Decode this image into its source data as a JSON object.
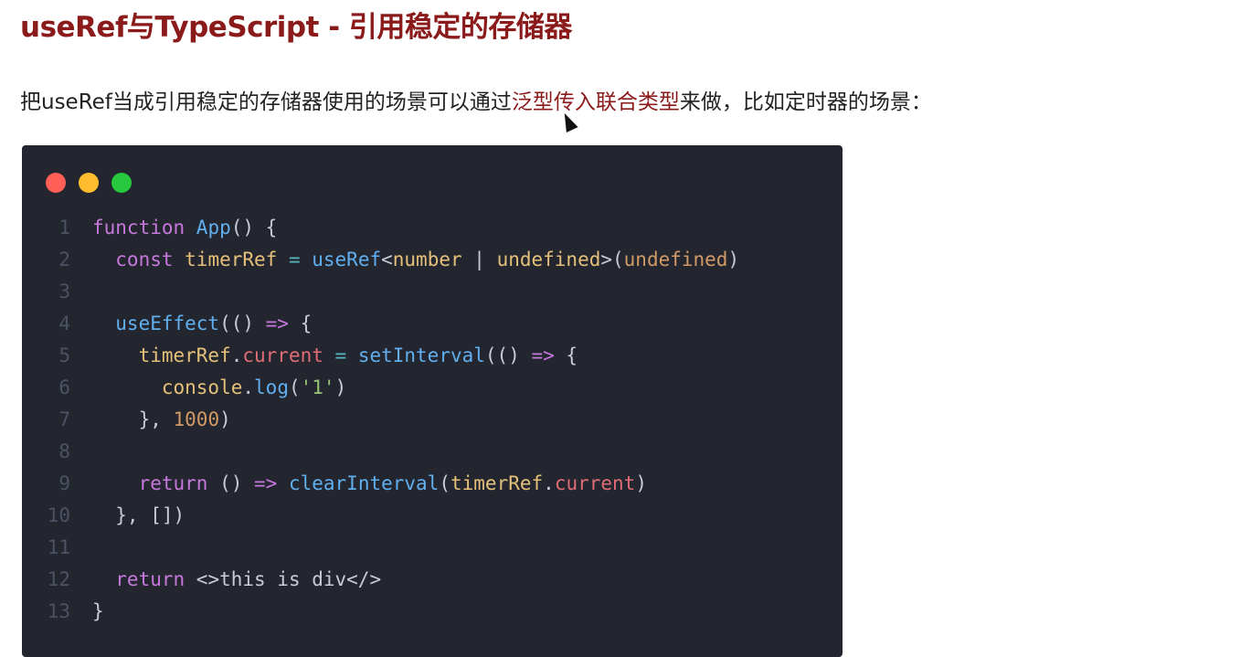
{
  "title": "useRef与TypeScript - 引用稳定的存储器",
  "paragraph": {
    "before": "把useRef当成引用稳定的存储器使用的场景可以通过",
    "highlight": "泛型传入联合类型",
    "after": "来做，比如定时器的场景："
  },
  "window_dots": [
    "#ff5f56",
    "#ffbd2e",
    "#27c93f"
  ],
  "code_lines": [
    {
      "num": "1",
      "tokens": [
        [
          "function ",
          "k"
        ],
        [
          "App",
          "f"
        ],
        [
          "() {",
          "t"
        ]
      ]
    },
    {
      "num": "2",
      "tokens": [
        [
          "  const ",
          "k"
        ],
        [
          "timerRef",
          "v"
        ],
        [
          " = ",
          "o"
        ],
        [
          "useRef",
          "f"
        ],
        [
          "<",
          "t"
        ],
        [
          "number",
          "v"
        ],
        [
          " | ",
          "t"
        ],
        [
          "undefined",
          "v"
        ],
        [
          ">(",
          "t"
        ],
        [
          "undefined",
          "n"
        ],
        [
          ")",
          "t"
        ]
      ]
    },
    {
      "num": "3",
      "tokens": []
    },
    {
      "num": "4",
      "tokens": [
        [
          "  useEffect",
          "f"
        ],
        [
          "(() ",
          "t"
        ],
        [
          "=>",
          "k"
        ],
        [
          " {",
          "t"
        ]
      ]
    },
    {
      "num": "5",
      "tokens": [
        [
          "    timerRef",
          "v"
        ],
        [
          ".",
          "t"
        ],
        [
          "current",
          "p"
        ],
        [
          " = ",
          "o"
        ],
        [
          "setInterval",
          "f"
        ],
        [
          "(() ",
          "t"
        ],
        [
          "=>",
          "k"
        ],
        [
          " {",
          "t"
        ]
      ]
    },
    {
      "num": "6",
      "tokens": [
        [
          "      console",
          "v"
        ],
        [
          ".",
          "t"
        ],
        [
          "log",
          "f"
        ],
        [
          "(",
          "t"
        ],
        [
          "'1'",
          "s"
        ],
        [
          ")",
          "t"
        ]
      ]
    },
    {
      "num": "7",
      "tokens": [
        [
          "    }, ",
          "t"
        ],
        [
          "1000",
          "n"
        ],
        [
          ")",
          "t"
        ]
      ]
    },
    {
      "num": "8",
      "tokens": []
    },
    {
      "num": "9",
      "tokens": [
        [
          "    return ",
          "k"
        ],
        [
          "() ",
          "t"
        ],
        [
          "=>",
          "k"
        ],
        [
          " ",
          "t"
        ],
        [
          "clearInterval",
          "f"
        ],
        [
          "(",
          "t"
        ],
        [
          "timerRef",
          "v"
        ],
        [
          ".",
          "t"
        ],
        [
          "current",
          "p"
        ],
        [
          ")",
          "t"
        ]
      ]
    },
    {
      "num": "10",
      "tokens": [
        [
          "  }, []",
          "t"
        ],
        [
          ")",
          "t"
        ]
      ]
    },
    {
      "num": "11",
      "tokens": []
    },
    {
      "num": "12",
      "tokens": [
        [
          "  return ",
          "k"
        ],
        [
          "<>this is div</>",
          "t"
        ]
      ]
    },
    {
      "num": "13",
      "tokens": [
        [
          "}",
          "t"
        ]
      ]
    }
  ]
}
